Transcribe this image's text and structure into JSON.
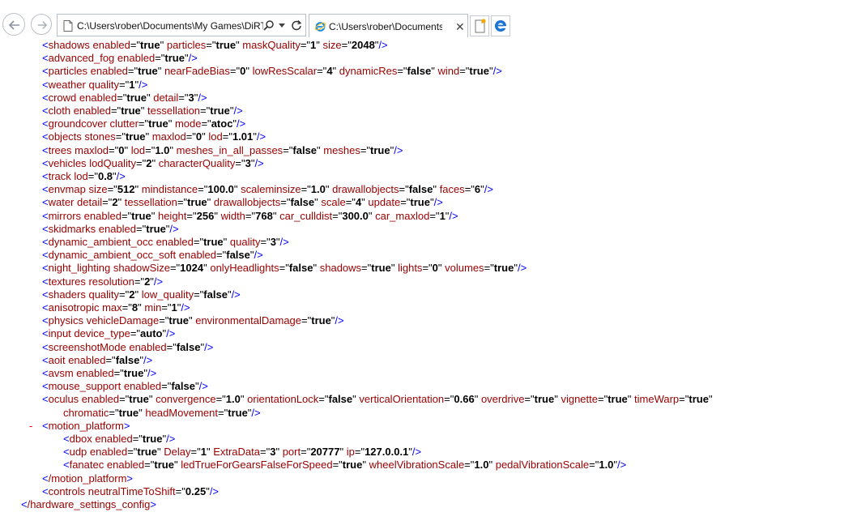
{
  "browser": {
    "address": "C:\\Users\\rober\\Documents\\My Games\\DiRT Rally\\hardwaresettings\\hardware_settings_config.xml",
    "tab_title": "C:\\Users\\rober\\Documents\\My Games\\DiRT Rally\\hardwaresettings\\hardware_settings_config.xml",
    "close_glyph": "✕"
  },
  "xml": {
    "collapse_glyph": "-",
    "lines": [
      {
        "indent": 52,
        "tag": "shadows",
        "attrs": [
          [
            "enabled",
            "true"
          ],
          [
            "particles",
            "true"
          ],
          [
            "maskQuality",
            "1"
          ],
          [
            "size",
            "2048"
          ]
        ],
        "end": "/>"
      },
      {
        "indent": 52,
        "tag": "advanced_fog",
        "attrs": [
          [
            "enabled",
            "true"
          ]
        ],
        "end": "/>"
      },
      {
        "indent": 52,
        "tag": "particles",
        "attrs": [
          [
            "enabled",
            "true"
          ],
          [
            "nearFadeBias",
            "0"
          ],
          [
            "lowResScalar",
            "4"
          ],
          [
            "dynamicRes",
            "false"
          ],
          [
            "wind",
            "true"
          ]
        ],
        "end": "/>"
      },
      {
        "indent": 52,
        "tag": "weather",
        "attrs": [
          [
            "quality",
            "1"
          ]
        ],
        "end": "/>"
      },
      {
        "indent": 52,
        "tag": "crowd",
        "attrs": [
          [
            "enabled",
            "true"
          ],
          [
            "detail",
            "3"
          ]
        ],
        "end": "/>"
      },
      {
        "indent": 52,
        "tag": "cloth",
        "attrs": [
          [
            "enabled",
            "true"
          ],
          [
            "tessellation",
            "true"
          ]
        ],
        "end": "/>"
      },
      {
        "indent": 52,
        "tag": "groundcover",
        "attrs": [
          [
            "clutter",
            "true"
          ],
          [
            "mode",
            "atoc"
          ]
        ],
        "end": "/>"
      },
      {
        "indent": 52,
        "tag": "objects",
        "attrs": [
          [
            "stones",
            "true"
          ],
          [
            "maxlod",
            "0"
          ],
          [
            "lod",
            "1.01"
          ]
        ],
        "end": "/>"
      },
      {
        "indent": 52,
        "tag": "trees",
        "attrs": [
          [
            "maxlod",
            "0"
          ],
          [
            "lod",
            "1.0"
          ],
          [
            "meshes_in_all_passes",
            "false"
          ],
          [
            "meshes",
            "true"
          ]
        ],
        "end": "/>"
      },
      {
        "indent": 52,
        "tag": "vehicles",
        "attrs": [
          [
            "lodQuality",
            "2"
          ],
          [
            "characterQuality",
            "3"
          ]
        ],
        "end": "/>"
      },
      {
        "indent": 52,
        "tag": "track",
        "attrs": [
          [
            "lod",
            "0.8"
          ]
        ],
        "end": "/>"
      },
      {
        "indent": 52,
        "tag": "envmap",
        "attrs": [
          [
            "size",
            "512"
          ],
          [
            "mindistance",
            "100.0"
          ],
          [
            "scaleminsize",
            "1.0"
          ],
          [
            "drawallobjects",
            "false"
          ],
          [
            "faces",
            "6"
          ]
        ],
        "end": "/>"
      },
      {
        "indent": 52,
        "tag": "water",
        "attrs": [
          [
            "detail",
            "2"
          ],
          [
            "tessellation",
            "true"
          ],
          [
            "drawallobjects",
            "false"
          ],
          [
            "scale",
            "4"
          ],
          [
            "update",
            "true"
          ]
        ],
        "end": "/>"
      },
      {
        "indent": 52,
        "tag": "mirrors",
        "attrs": [
          [
            "enabled",
            "true"
          ],
          [
            "height",
            "256"
          ],
          [
            "width",
            "768"
          ],
          [
            "car_culldist",
            "300.0"
          ],
          [
            "car_maxlod",
            "1"
          ]
        ],
        "end": "/>"
      },
      {
        "indent": 52,
        "tag": "skidmarks",
        "attrs": [
          [
            "enabled",
            "true"
          ]
        ],
        "end": "/>"
      },
      {
        "indent": 52,
        "tag": "dynamic_ambient_occ",
        "attrs": [
          [
            "enabled",
            "true"
          ],
          [
            "quality",
            "3"
          ]
        ],
        "end": "/>"
      },
      {
        "indent": 52,
        "tag": "dynamic_ambient_occ_soft",
        "attrs": [
          [
            "enabled",
            "false"
          ]
        ],
        "end": "/>"
      },
      {
        "indent": 52,
        "tag": "night_lighting",
        "attrs": [
          [
            "shadowSize",
            "1024"
          ],
          [
            "onlyHeadlights",
            "false"
          ],
          [
            "shadows",
            "true"
          ],
          [
            "lights",
            "0"
          ],
          [
            "volumes",
            "true"
          ]
        ],
        "end": "/>"
      },
      {
        "indent": 52,
        "tag": "textures",
        "attrs": [
          [
            "resolution",
            "2"
          ]
        ],
        "end": "/>"
      },
      {
        "indent": 52,
        "tag": "shaders",
        "attrs": [
          [
            "quality",
            "2"
          ],
          [
            "low_quality",
            "false"
          ]
        ],
        "end": "/>"
      },
      {
        "indent": 52,
        "tag": "anisotropic",
        "attrs": [
          [
            "max",
            "8"
          ],
          [
            "min",
            "1"
          ]
        ],
        "end": "/>"
      },
      {
        "indent": 52,
        "tag": "physics",
        "attrs": [
          [
            "vehicleDamage",
            "true"
          ],
          [
            "environmentalDamage",
            "true"
          ]
        ],
        "end": "/>"
      },
      {
        "indent": 52,
        "tag": "input",
        "attrs": [
          [
            "device_type",
            "auto"
          ]
        ],
        "end": "/>"
      },
      {
        "indent": 52,
        "tag": "screenshotMode",
        "attrs": [
          [
            "enabled",
            "false"
          ]
        ],
        "end": "/>"
      },
      {
        "indent": 52,
        "tag": "aoit",
        "attrs": [
          [
            "enabled",
            "false"
          ]
        ],
        "end": "/>"
      },
      {
        "indent": 52,
        "tag": "avsm",
        "attrs": [
          [
            "enabled",
            "true"
          ]
        ],
        "end": "/>"
      },
      {
        "indent": 52,
        "tag": "mouse_support",
        "attrs": [
          [
            "enabled",
            "false"
          ]
        ],
        "end": "/>"
      },
      {
        "indent": 52,
        "tag": "oculus",
        "attrs": [
          [
            "enabled",
            "true"
          ],
          [
            "convergence",
            "1.0"
          ],
          [
            "orientationLock",
            "false"
          ],
          [
            "verticalOrientation",
            "0.66"
          ],
          [
            "overdrive",
            "true"
          ],
          [
            "vignette",
            "true"
          ],
          [
            "timeWarp",
            "true"
          ]
        ],
        "end": ""
      },
      {
        "indent": 78,
        "tag": "",
        "attrs": [
          [
            "chromatic",
            "true"
          ],
          [
            "headMovement",
            "true"
          ]
        ],
        "end": "/>"
      },
      {
        "indent": 52,
        "tag": "motion_platform",
        "attrs": [],
        "end": ">",
        "collapse": true
      },
      {
        "indent": 78,
        "tag": "dbox",
        "attrs": [
          [
            "enabled",
            "true"
          ]
        ],
        "end": "/>"
      },
      {
        "indent": 78,
        "tag": "udp",
        "attrs": [
          [
            "enabled",
            "true"
          ],
          [
            "Delay",
            "1"
          ],
          [
            "ExtraData",
            "3"
          ],
          [
            "port",
            "20777"
          ],
          [
            "ip",
            "127.0.0.1"
          ]
        ],
        "end": "/>"
      },
      {
        "indent": 78,
        "tag": "fanatec",
        "attrs": [
          [
            "enabled",
            "true"
          ],
          [
            "ledTrueForGearsFalseForSpeed",
            "true"
          ],
          [
            "wheelVibrationScale",
            "1.0"
          ],
          [
            "pedalVibrationScale",
            "1.0"
          ]
        ],
        "end": "/>"
      },
      {
        "indent": 52,
        "tag": "/motion_platform",
        "attrs": [],
        "end": ">"
      },
      {
        "indent": 52,
        "tag": "controls",
        "attrs": [
          [
            "neutralTimeToShift",
            "0.25"
          ]
        ],
        "end": "/>"
      },
      {
        "indent": 26,
        "tag": "/hardware_settings_config",
        "attrs": [],
        "end": ">"
      }
    ]
  }
}
